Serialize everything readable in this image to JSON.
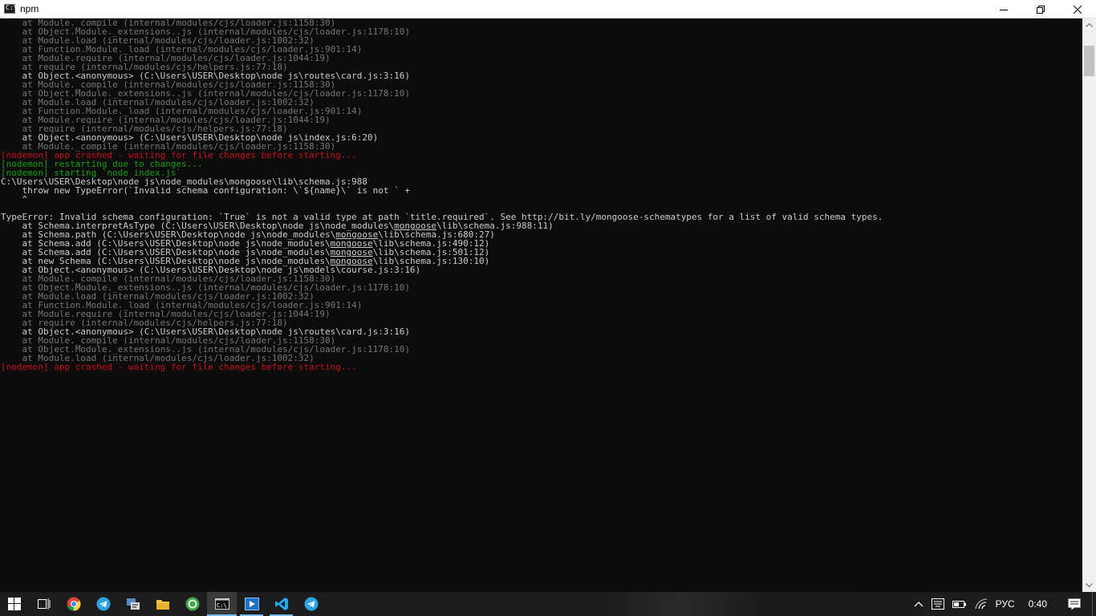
{
  "window": {
    "title": "npm",
    "icon": "console-icon",
    "icon_glyph": "C:\\"
  },
  "console": {
    "lines": [
      {
        "color": "gray",
        "segments": [
          {
            "text": "    at Module._compile (internal/modules/cjs/loader.js:1158:30)"
          }
        ]
      },
      {
        "color": "gray",
        "segments": [
          {
            "text": "    at Object.Module._extensions..js (internal/modules/cjs/loader.js:1178:10)"
          }
        ]
      },
      {
        "color": "gray",
        "segments": [
          {
            "text": "    at Module.load (internal/modules/cjs/loader.js:1002:32)"
          }
        ]
      },
      {
        "color": "gray",
        "segments": [
          {
            "text": "    at Function.Module._load (internal/modules/cjs/loader.js:901:14)"
          }
        ]
      },
      {
        "color": "gray",
        "segments": [
          {
            "text": "    at Module.require (internal/modules/cjs/loader.js:1044:19)"
          }
        ]
      },
      {
        "color": "gray",
        "segments": [
          {
            "text": "    at require (internal/modules/cjs/helpers.js:77:18)"
          }
        ]
      },
      {
        "color": "white",
        "segments": [
          {
            "text": "    at Object.<anonymous> (C:\\Users\\USER\\Desktop\\node js\\routes\\card.js:3:16)"
          }
        ]
      },
      {
        "color": "gray",
        "segments": [
          {
            "text": "    at Module._compile (internal/modules/cjs/loader.js:1158:30)"
          }
        ]
      },
      {
        "color": "gray",
        "segments": [
          {
            "text": "    at Object.Module._extensions..js (internal/modules/cjs/loader.js:1178:10)"
          }
        ]
      },
      {
        "color": "gray",
        "segments": [
          {
            "text": "    at Module.load (internal/modules/cjs/loader.js:1002:32)"
          }
        ]
      },
      {
        "color": "gray",
        "segments": [
          {
            "text": "    at Function.Module._load (internal/modules/cjs/loader.js:901:14)"
          }
        ]
      },
      {
        "color": "gray",
        "segments": [
          {
            "text": "    at Module.require (internal/modules/cjs/loader.js:1044:19)"
          }
        ]
      },
      {
        "color": "gray",
        "segments": [
          {
            "text": "    at require (internal/modules/cjs/helpers.js:77:18)"
          }
        ]
      },
      {
        "color": "white",
        "segments": [
          {
            "text": "    at Object.<anonymous> (C:\\Users\\USER\\Desktop\\node js\\index.js:6:20)"
          }
        ]
      },
      {
        "color": "gray",
        "segments": [
          {
            "text": "    at Module._compile (internal/modules/cjs/loader.js:1158:30)"
          }
        ]
      },
      {
        "color": "red",
        "segments": [
          {
            "text": "[nodemon] app crashed - waiting for file changes before starting..."
          }
        ]
      },
      {
        "color": "green",
        "segments": [
          {
            "text": "[nodemon] restarting due to changes..."
          }
        ]
      },
      {
        "color": "green",
        "segments": [
          {
            "text": "[nodemon] starting `node index.js`"
          }
        ]
      },
      {
        "color": "white",
        "segments": [
          {
            "text": "C:\\Users\\USER\\Desktop\\node js\\node_modules\\mongoose\\lib\\schema.js:988"
          }
        ]
      },
      {
        "color": "white",
        "segments": [
          {
            "text": "    throw new TypeError(`Invalid schema configuration: \\`${name}\\` is not ` +"
          }
        ]
      },
      {
        "color": "white",
        "segments": [
          {
            "text": "    ^"
          }
        ]
      },
      {
        "color": "white",
        "segments": [
          {
            "text": ""
          }
        ]
      },
      {
        "color": "white",
        "segments": [
          {
            "text": "TypeError: Invalid schema configuration: `True` is not a valid type at path `title.required`. See http://bit.ly/mongoose-schematypes for a list of valid schema types."
          }
        ]
      },
      {
        "color": "white",
        "segments": [
          {
            "text": "    at Schema.interpretAsType (C:\\Users\\USER\\Desktop\\node js\\node_modules\\"
          },
          {
            "text": "mongoose",
            "underline": true
          },
          {
            "text": "\\lib\\schema.js:988:11)"
          }
        ]
      },
      {
        "color": "white",
        "segments": [
          {
            "text": "    at Schema.path (C:\\Users\\USER\\Desktop\\node js\\node_modules\\"
          },
          {
            "text": "mongoose",
            "underline": true
          },
          {
            "text": "\\lib\\schema.js:680:27)"
          }
        ]
      },
      {
        "color": "white",
        "segments": [
          {
            "text": "    at Schema.add (C:\\Users\\USER\\Desktop\\node js\\node_modules\\"
          },
          {
            "text": "mongoose",
            "underline": true
          },
          {
            "text": "\\lib\\schema.js:490:12)"
          }
        ]
      },
      {
        "color": "white",
        "segments": [
          {
            "text": "    at Schema.add (C:\\Users\\USER\\Desktop\\node js\\node_modules\\"
          },
          {
            "text": "mongoose",
            "underline": true
          },
          {
            "text": "\\lib\\schema.js:501:12)"
          }
        ]
      },
      {
        "color": "white",
        "segments": [
          {
            "text": "    at new Schema (C:\\Users\\USER\\Desktop\\node js\\node_modules\\"
          },
          {
            "text": "mongoose",
            "underline": true
          },
          {
            "text": "\\lib\\schema.js:130:10)"
          }
        ]
      },
      {
        "color": "white",
        "segments": [
          {
            "text": "    at Object.<anonymous> (C:\\Users\\USER\\Desktop\\node js\\models\\course.js:3:16)"
          }
        ]
      },
      {
        "color": "gray",
        "segments": [
          {
            "text": "    at Module._compile (internal/modules/cjs/loader.js:1158:30)"
          }
        ]
      },
      {
        "color": "gray",
        "segments": [
          {
            "text": "    at Object.Module._extensions..js (internal/modules/cjs/loader.js:1178:10)"
          }
        ]
      },
      {
        "color": "gray",
        "segments": [
          {
            "text": "    at Module.load (internal/modules/cjs/loader.js:1002:32)"
          }
        ]
      },
      {
        "color": "gray",
        "segments": [
          {
            "text": "    at Function.Module._load (internal/modules/cjs/loader.js:901:14)"
          }
        ]
      },
      {
        "color": "gray",
        "segments": [
          {
            "text": "    at Module.require (internal/modules/cjs/loader.js:1044:19)"
          }
        ]
      },
      {
        "color": "gray",
        "segments": [
          {
            "text": "    at require (internal/modules/cjs/helpers.js:77:18)"
          }
        ]
      },
      {
        "color": "white",
        "segments": [
          {
            "text": "    at Object.<anonymous> (C:\\Users\\USER\\Desktop\\node js\\routes\\card.js:3:16)"
          }
        ]
      },
      {
        "color": "gray",
        "segments": [
          {
            "text": "    at Module._compile (internal/modules/cjs/loader.js:1158:30)"
          }
        ]
      },
      {
        "color": "gray",
        "segments": [
          {
            "text": "    at Object.Module._extensions..js (internal/modules/cjs/loader.js:1178:10)"
          }
        ]
      },
      {
        "color": "gray",
        "segments": [
          {
            "text": "    at Module.load (internal/modules/cjs/loader.js:1002:32)"
          }
        ]
      },
      {
        "color": "red",
        "segments": [
          {
            "text": "[nodemon] app crashed - waiting for file changes before starting..."
          }
        ]
      }
    ],
    "colors": {
      "background": "#0c0c0c",
      "white": "#cccccc",
      "gray": "#767676",
      "red": "#c50f1f",
      "green": "#13a10e"
    }
  },
  "taskbar": {
    "items": [
      {
        "name": "start-button",
        "icon": "windows-icon"
      },
      {
        "name": "task-view-button",
        "icon": "task-view-icon"
      },
      {
        "name": "taskbar-chrome",
        "icon": "chrome-icon"
      },
      {
        "name": "taskbar-telegram",
        "icon": "telegram-icon"
      },
      {
        "name": "taskbar-app",
        "icon": "app-icon"
      },
      {
        "name": "taskbar-explorer",
        "icon": "folder-icon"
      },
      {
        "name": "taskbar-app-green",
        "icon": "green-app-icon"
      },
      {
        "name": "taskbar-cmd",
        "icon": "console-icon",
        "active": true
      },
      {
        "name": "taskbar-player",
        "icon": "player-icon"
      },
      {
        "name": "taskbar-vscode",
        "icon": "vscode-icon"
      },
      {
        "name": "taskbar-telegram-2",
        "icon": "telegram-icon"
      }
    ],
    "tray": {
      "language": "РУС",
      "clock": "0:40"
    }
  }
}
